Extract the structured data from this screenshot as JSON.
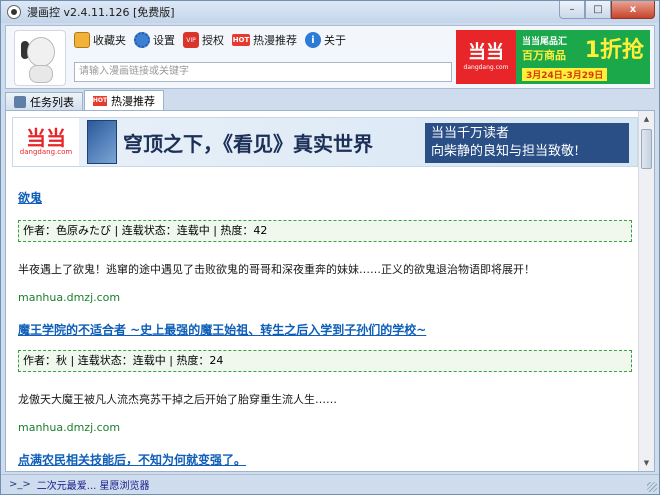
{
  "window": {
    "title": "漫画控 v2.4.11.126 [免费版]",
    "minimize": "–",
    "maximize": "□",
    "close": "x"
  },
  "toolbar": {
    "items": [
      {
        "label": "收藏夹",
        "icon": "star-folder-icon"
      },
      {
        "label": "设置",
        "icon": "gear-icon"
      },
      {
        "label": "授权",
        "icon": "vip-icon"
      },
      {
        "label": "热漫推荐",
        "icon": "hot-icon"
      },
      {
        "label": "关于",
        "icon": "info-icon"
      }
    ],
    "vip_text": "VIP",
    "hot_text": "HOT",
    "about_text": "i"
  },
  "search": {
    "placeholder": "请输入漫画链接或关键字"
  },
  "top_ad": {
    "logo": "当当",
    "domain": "dangdang.com",
    "line1": "当当尾品汇",
    "line2": "百万商品",
    "big": "1折抢",
    "dates": "3月24日-3月29日"
  },
  "tabs": [
    {
      "label": "任务列表",
      "active": false
    },
    {
      "label": "热漫推荐",
      "active": true
    }
  ],
  "tab_hot_badge": "HOT",
  "banner": {
    "logo": "当当",
    "domain": "dangdang.com",
    "headline": "穹顶之下，《看见》真实世界",
    "sub_line1": "当当千万读者",
    "sub_line2": "向柴静的良知与担当致敬!"
  },
  "entries": [
    {
      "title": "欲鬼",
      "meta": "作者：色原みたび | 连载状态：连载中 | 热度：42",
      "desc": "半夜遇上了欲鬼！逃窜的途中遇见了击败欲鬼的哥哥和深夜重奔的妹妹……正义的欲鬼退治物语即将展开！",
      "source": "manhua.dmzj.com"
    },
    {
      "title": "魔王学院的不适合者 ~史上最强的魔王始祖、转生之后入学到子孙们的学校~",
      "meta": "作者：秋 | 连载状态：连载中 | 热度：24",
      "desc": "龙傲天大魔王被凡人流杰亮苏干掉之后开始了胎穿重生流人生……",
      "source": "manhua.dmzj.com"
    },
    {
      "title": "点满农民相关技能后，不知为何就变强了。"
    }
  ],
  "status": {
    "prompt": ">_>",
    "text": "二次元最爱...  星愿浏览器"
  }
}
